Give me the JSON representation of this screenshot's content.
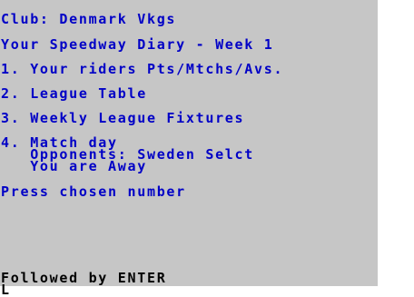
{
  "screen": {
    "club_line": "Club: Denmark Vkgs",
    "title_line": "Your Speedway Diary - Week 1",
    "menu": [
      "1. Your riders Pts/Mtchs/Avs.",
      "2. League Table",
      "3. Weekly League Fixtures",
      "4. Match day"
    ],
    "opponents_line": "   Opponents: Sweden Selct",
    "venue_line": "   You are Away",
    "prompt": "Press chosen number",
    "enter_hint": "Followed by ENTER",
    "cursor": "L"
  },
  "colors": {
    "paper": "#c6c6c6",
    "ink": "#0000c6",
    "border": "#ffffff"
  }
}
